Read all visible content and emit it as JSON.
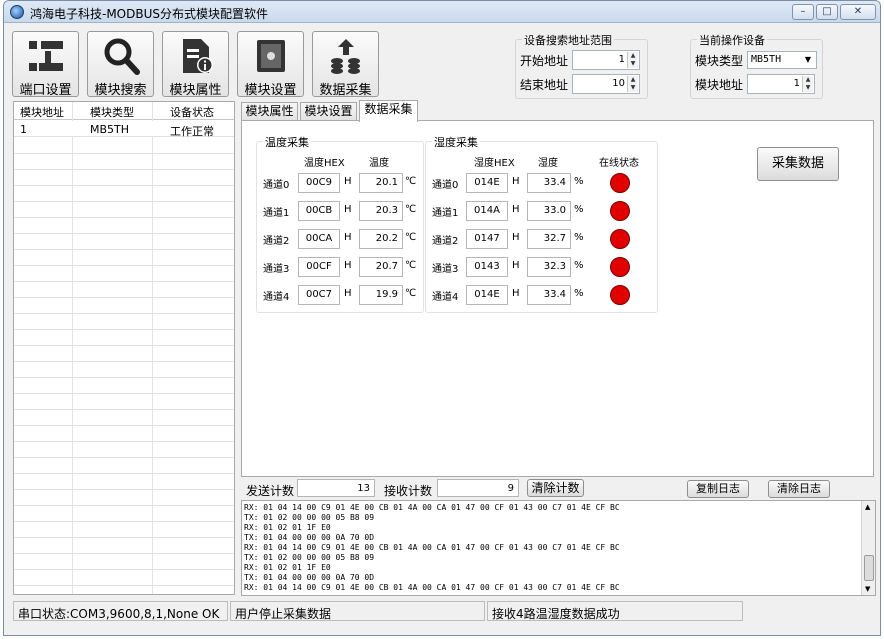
{
  "window": {
    "title": "鸿海电子科技-MODBUS分布式模块配置软件"
  },
  "toolbar": [
    {
      "label": "端口设置",
      "icon": "port-settings-icon"
    },
    {
      "label": "模块搜索",
      "icon": "search-icon"
    },
    {
      "label": "模块属性",
      "icon": "properties-icon"
    },
    {
      "label": "模块设置",
      "icon": "device-settings-icon"
    },
    {
      "label": "数据采集",
      "icon": "data-collect-icon"
    }
  ],
  "search_range": {
    "title": "设备搜索地址范围",
    "start_label": "开始地址",
    "start_value": "1",
    "end_label": "结束地址",
    "end_value": "10"
  },
  "current_device": {
    "title": "当前操作设备",
    "type_label": "模块类型",
    "type_value": "MB5TH",
    "addr_label": "模块地址",
    "addr_value": "1"
  },
  "device_list": {
    "headers": [
      "模块地址",
      "模块类型",
      "设备状态"
    ],
    "rows": [
      {
        "addr": "1",
        "type": "MB5TH",
        "status": "工作正常"
      }
    ]
  },
  "tabs": [
    "模块属性",
    "模块设置",
    "数据采集"
  ],
  "temperature": {
    "title": "温度采集",
    "hex_header": "温度HEX",
    "value_header": "温度",
    "hex_unit": "H",
    "unit": "℃",
    "channels": [
      {
        "name": "通道0",
        "hex": "00C9",
        "value": "20.1"
      },
      {
        "name": "通道1",
        "hex": "00CB",
        "value": "20.3"
      },
      {
        "name": "通道2",
        "hex": "00CA",
        "value": "20.2"
      },
      {
        "name": "通道3",
        "hex": "00CF",
        "value": "20.7"
      },
      {
        "name": "通道4",
        "hex": "00C7",
        "value": "19.9"
      }
    ]
  },
  "humidity": {
    "title": "湿度采集",
    "hex_header": "湿度HEX",
    "value_header": "湿度",
    "status_header": "在线状态",
    "hex_unit": "H",
    "unit": "%",
    "channels": [
      {
        "name": "通道0",
        "hex": "014E",
        "value": "33.4"
      },
      {
        "name": "通道1",
        "hex": "014A",
        "value": "33.0"
      },
      {
        "name": "通道2",
        "hex": "0147",
        "value": "32.7"
      },
      {
        "name": "通道3",
        "hex": "0143",
        "value": "32.3"
      },
      {
        "name": "通道4",
        "hex": "014E",
        "value": "33.4"
      }
    ],
    "status_color": "#e00000"
  },
  "collect_button": "采集数据",
  "counters": {
    "send_label": "发送计数",
    "send_value": "13",
    "recv_label": "接收计数",
    "recv_value": "9",
    "clear_label": "清除计数",
    "copy_log_label": "复制日志",
    "clear_log_label": "清除日志"
  },
  "log_lines": [
    "RX: 01 04 14 00 C9 01 4E 00 CB 01 4A 00 CA 01 47 00 CF 01 43 00 C7 01 4E CF BC",
    "TX: 01 02 00 00 00 05 B8 09",
    "RX: 01 02 01 1F E0",
    "TX: 01 04 00 00 00 0A 70 0D",
    "RX: 01 04 14 00 C9 01 4E 00 CB 01 4A 00 CA 01 47 00 CF 01 43 00 C7 01 4E CF BC",
    "TX: 01 02 00 00 00 05 B8 09",
    "RX: 01 02 01 1F E0",
    "TX: 01 04 00 00 00 0A 70 0D",
    "RX: 01 04 14 00 C9 01 4E 00 CB 01 4A 00 CA 01 47 00 CF 01 43 00 C7 01 4E CF BC"
  ],
  "statusbar": {
    "port": "串口状态:COM3,9600,8,1,None OK",
    "user": "用户停止采集数据",
    "result": "接收4路温湿度数据成功"
  }
}
